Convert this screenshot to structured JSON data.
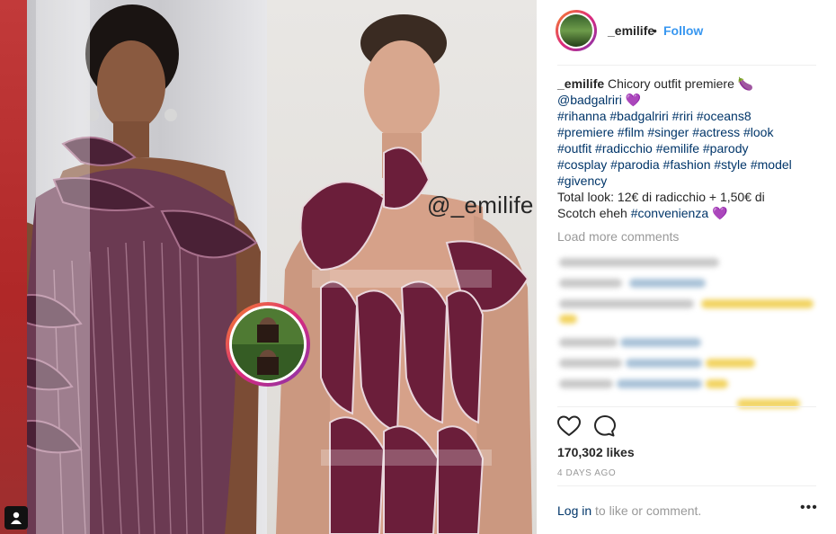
{
  "media": {
    "watermark": "@_emilife",
    "center_avatar": "profile-avatar"
  },
  "header": {
    "username": "_emilife",
    "separator": "•",
    "follow_label": "Follow"
  },
  "caption": {
    "username": "_emilife",
    "title": "Chicory outfit premiere 🍆",
    "mention": "@badgalriri",
    "heart": "💜",
    "hashtags": [
      "#rihanna",
      "#badgalriri",
      "#riri",
      "#oceans8",
      "#premiere",
      "#film",
      "#singer",
      "#actress",
      "#look",
      "#outfit",
      "#radicchio",
      "#emilife",
      "#parody",
      "#cosplay",
      "#parodia",
      "#fashion",
      "#style",
      "#model",
      "#givency"
    ],
    "line2": "Total look: 12€ di radicchio + 1,50€ di",
    "line3": "Scotch eheh",
    "tag_end": "#convenienza",
    "heart_end": "💜"
  },
  "comments": {
    "load_more": "Load more comments"
  },
  "actions": {
    "like_icon": "heart-icon",
    "comment_icon": "comment-icon"
  },
  "likes": "170,302 likes",
  "time_ago": "4 DAYS AGO",
  "footer": {
    "login_label": "Log in",
    "rest": " to like or comment.",
    "more": "•••"
  },
  "colors": {
    "link": "#003569",
    "follow": "#3897f0",
    "muted": "#999999"
  }
}
